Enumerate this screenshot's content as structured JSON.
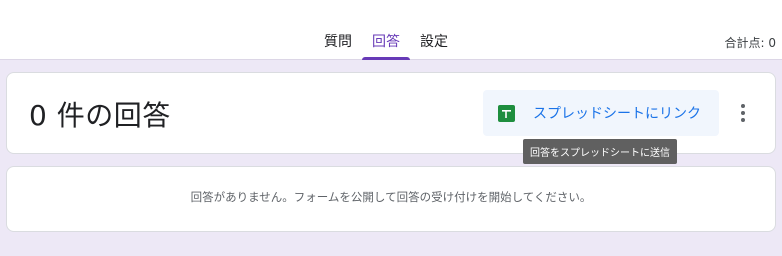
{
  "tabs": [
    {
      "label": "質問",
      "active": false
    },
    {
      "label": "回答",
      "active": true
    },
    {
      "label": "設定",
      "active": false
    }
  ],
  "total_points": "合計点: 0",
  "summary": {
    "count_text": "0 件の回答",
    "sheets_button_label": "スプレッドシートにリンク",
    "sheets_icon": "google-sheets-icon",
    "more_icon": "more-vert-icon"
  },
  "tooltip": "回答をスプレッドシートに送信",
  "empty_message": "回答がありません。フォームを公開して回答の受け付けを開始してください。",
  "colors": {
    "accent": "#673ab7",
    "background": "#ede8f6",
    "link": "#1a73e8",
    "sheets_green": "#1e8e3e"
  }
}
